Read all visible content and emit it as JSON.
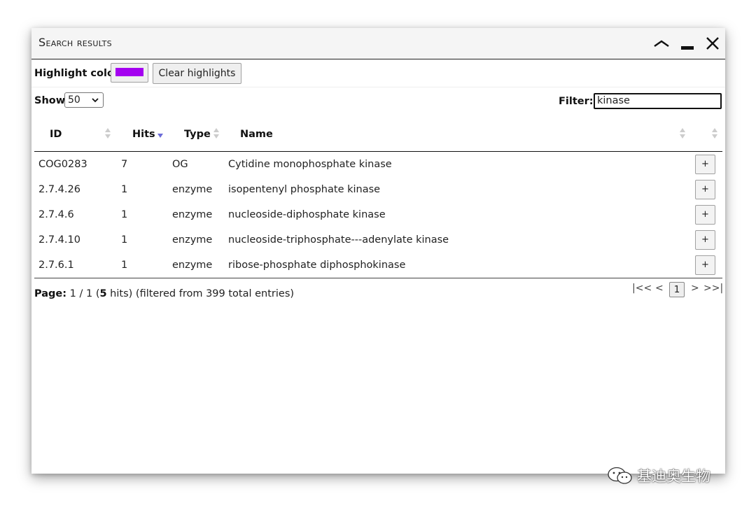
{
  "window": {
    "title": "Search results"
  },
  "toolbar": {
    "highlight_label": "Highlight color:",
    "highlight_color": "#a400f0",
    "clear_label": "Clear highlights"
  },
  "controls": {
    "show_label": "Show:",
    "show_value": "50",
    "filter_label": "Filter:",
    "filter_value": "kinase"
  },
  "table": {
    "columns": [
      "ID",
      "Hits",
      "Type",
      "Name"
    ],
    "sorted_column": "Hits",
    "rows": [
      {
        "id": "COG0283",
        "hits": "7",
        "type": "OG",
        "name": "Cytidine monophosphate kinase",
        "action": "+"
      },
      {
        "id": "2.7.4.26",
        "hits": "1",
        "type": "enzyme",
        "name": "isopentenyl phosphate kinase",
        "action": "+"
      },
      {
        "id": "2.7.4.6",
        "hits": "1",
        "type": "enzyme",
        "name": "nucleoside-diphosphate kinase",
        "action": "+"
      },
      {
        "id": "2.7.4.10",
        "hits": "1",
        "type": "enzyme",
        "name": "nucleoside-triphosphate---adenylate kinase",
        "action": "+"
      },
      {
        "id": "2.7.6.1",
        "hits": "1",
        "type": "enzyme",
        "name": "ribose-phosphate diphosphokinase",
        "action": "+"
      }
    ]
  },
  "footer": {
    "page_label": "Page:",
    "page_text": "1 / 1 (",
    "hits_count": "5",
    "hits_text": " hits) (filtered from 399 total entries)",
    "pager": {
      "first": "|<<",
      "prev": "<",
      "current": "1",
      "next": ">",
      "last": ">>|"
    }
  },
  "watermark": {
    "text": "基迪奥生物",
    "icon": "wechat-icon"
  }
}
